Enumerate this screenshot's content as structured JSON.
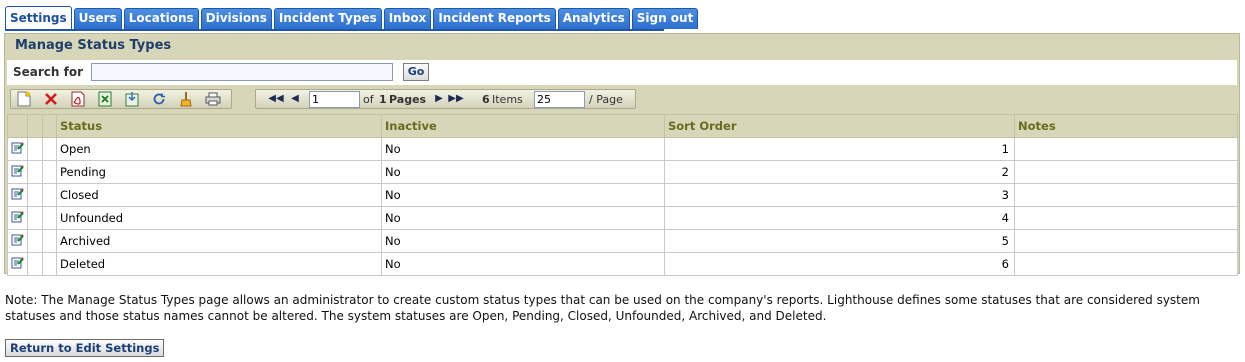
{
  "tabs": [
    "Settings",
    "Users",
    "Locations",
    "Divisions",
    "Incident Types",
    "Inbox",
    "Incident Reports",
    "Analytics",
    "Sign out"
  ],
  "active_tab": "Settings",
  "panel": {
    "title": "Manage Status Types"
  },
  "search": {
    "label": "Search for",
    "value": "",
    "go_label": "Go"
  },
  "toolbar": {
    "icons": [
      "new-icon",
      "delete-icon",
      "pdf-export-icon",
      "excel-export-icon",
      "import-icon",
      "refresh-icon",
      "clear-filter-icon",
      "print-icon"
    ]
  },
  "pager": {
    "page_value": "1",
    "of_text": "of",
    "total_pages": "1",
    "pages_text": "Pages",
    "item_count": "6",
    "items_text": "Items",
    "page_size_value": "25",
    "per_page_text": "/ Page"
  },
  "table": {
    "columns": [
      "Status",
      "Inactive",
      "Sort Order",
      "Notes"
    ],
    "rows": [
      {
        "status": "Open",
        "inactive": "No",
        "sort": "1",
        "notes": ""
      },
      {
        "status": "Pending",
        "inactive": "No",
        "sort": "2",
        "notes": ""
      },
      {
        "status": "Closed",
        "inactive": "No",
        "sort": "3",
        "notes": ""
      },
      {
        "status": "Unfounded",
        "inactive": "No",
        "sort": "4",
        "notes": ""
      },
      {
        "status": "Archived",
        "inactive": "No",
        "sort": "5",
        "notes": ""
      },
      {
        "status": "Deleted",
        "inactive": "No",
        "sort": "6",
        "notes": ""
      }
    ]
  },
  "note": "Note: The Manage Status Types page allows an administrator to create custom status types that can be used on the company's reports. Lighthouse defines some statuses that are considered system statuses and those status names cannot be altered. The system statuses are Open, Pending, Closed, Unfounded, Archived, and Deleted.",
  "return_button": "Return to Edit Settings"
}
